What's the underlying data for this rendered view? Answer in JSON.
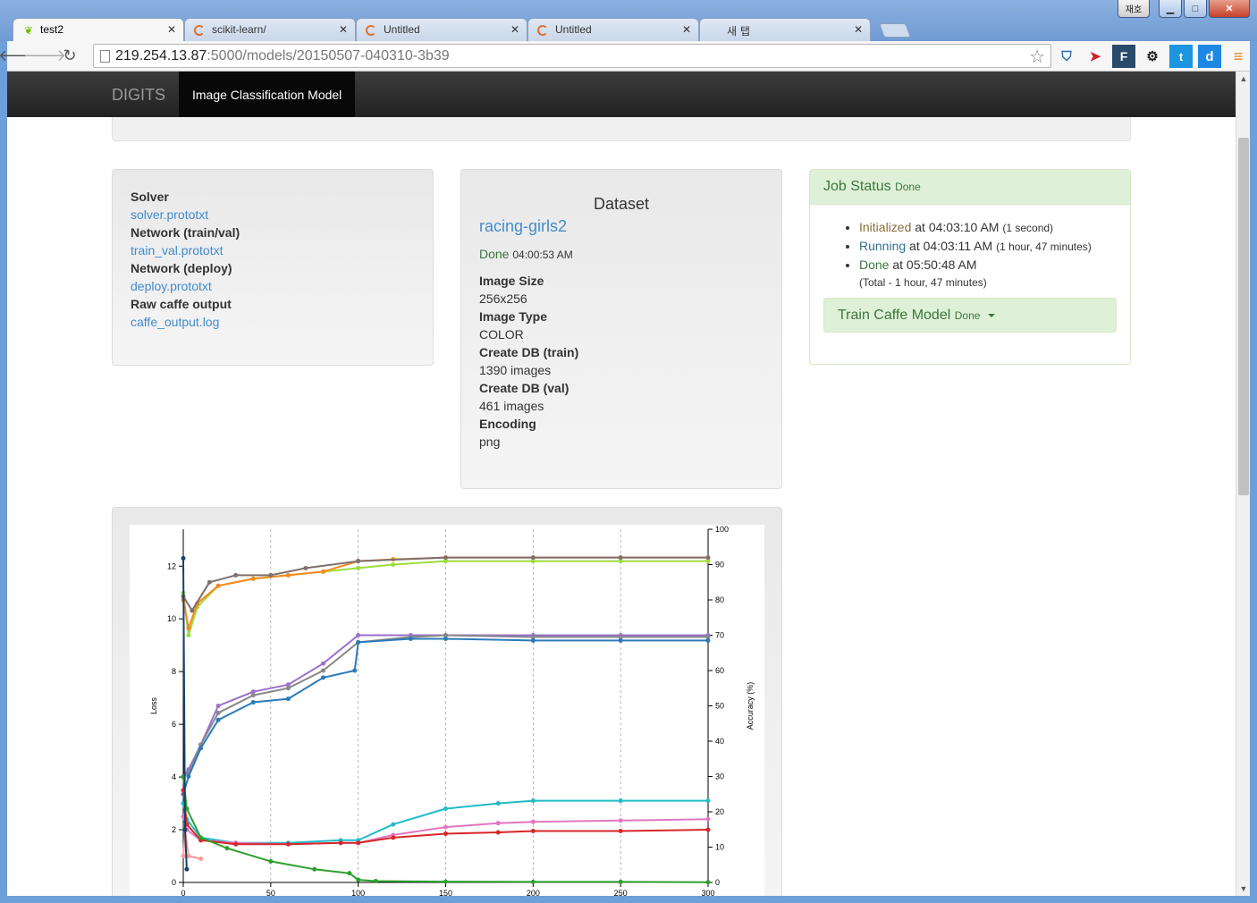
{
  "window": {
    "user_label": "재호",
    "tabs": [
      {
        "title": "test2",
        "icon": "nvidia-leaf-icon",
        "active": true
      },
      {
        "title": "scikit-learn/",
        "icon": "ipython-icon",
        "active": false
      },
      {
        "title": "Untitled",
        "icon": "ipython-icon",
        "active": false
      },
      {
        "title": "Untitled",
        "icon": "ipython-icon",
        "active": false
      },
      {
        "title": "새 탭",
        "icon": "",
        "active": false
      }
    ],
    "url_host": "219.254.13.87",
    "url_path": ":5000/models/20150507-040310-3b39"
  },
  "navbar": {
    "brand": "DIGITS",
    "active_item": "Image Classification Model"
  },
  "files": [
    {
      "label": "Solver",
      "link": "solver.prototxt"
    },
    {
      "label": "Network (train/val)",
      "link": "train_val.prototxt"
    },
    {
      "label": "Network (deploy)",
      "link": "deploy.prototxt"
    },
    {
      "label": "Raw caffe output",
      "link": "caffe_output.log"
    }
  ],
  "dataset": {
    "heading": "Dataset",
    "name": "racing-girls2",
    "status": "Done",
    "status_time": "04:00:53 AM",
    "fields": [
      {
        "label": "Image Size",
        "value": "256x256"
      },
      {
        "label": "Image Type",
        "value": "COLOR"
      },
      {
        "label": "Create DB (train)",
        "value": "1390 images"
      },
      {
        "label": "Create DB (val)",
        "value": "461 images"
      },
      {
        "label": "Encoding",
        "value": "png"
      }
    ]
  },
  "job_status": {
    "title": "Job Status",
    "state": "Done",
    "events": [
      {
        "state": "Initialized",
        "at": "at 04:03:10 AM",
        "duration": "(1 second)"
      },
      {
        "state": "Running",
        "at": "at 04:03:11 AM",
        "duration": "(1 hour, 47 minutes)"
      },
      {
        "state": "Done",
        "at": "at 05:50:48 AM",
        "duration": ""
      }
    ],
    "total": "(Total - 1 hour, 47 minutes)",
    "task_name": "Train Caffe Model",
    "task_state": "Done"
  },
  "chart_data": {
    "type": "line",
    "ylabel_left": "Loss",
    "ylabel_right": "Accuracy (%)",
    "xlim": [
      0,
      300
    ],
    "ylim_left": [
      0,
      13.4
    ],
    "ylim_right": [
      0,
      100
    ],
    "x_ticks": [
      0,
      50,
      100,
      150,
      200,
      250,
      300
    ],
    "y_ticks_left": [
      0,
      2,
      4,
      6,
      8,
      10,
      12
    ],
    "y_ticks_right": [
      0,
      10,
      20,
      30,
      40,
      50,
      60,
      70,
      80,
      90,
      100
    ],
    "grid": "vertical dashed at x ticks",
    "legend": "none visible",
    "series": [
      {
        "axis": "right",
        "color": "#9edc3c",
        "points": [
          [
            0,
            82
          ],
          [
            3,
            70
          ],
          [
            8,
            78
          ],
          [
            20,
            84
          ],
          [
            40,
            86
          ],
          [
            60,
            87
          ],
          [
            80,
            88
          ],
          [
            100,
            89
          ],
          [
            120,
            90
          ],
          [
            150,
            91
          ],
          [
            200,
            91
          ],
          [
            250,
            91
          ],
          [
            300,
            91
          ]
        ]
      },
      {
        "axis": "right",
        "color": "#f58a1f",
        "points": [
          [
            0,
            80
          ],
          [
            3,
            72
          ],
          [
            8,
            79
          ],
          [
            20,
            84
          ],
          [
            40,
            86
          ],
          [
            60,
            87
          ],
          [
            80,
            88
          ],
          [
            100,
            91
          ],
          [
            120,
            91.5
          ],
          [
            150,
            92
          ],
          [
            200,
            92
          ],
          [
            250,
            92
          ],
          [
            300,
            92
          ]
        ]
      },
      {
        "axis": "right",
        "color": "#7f6f6f",
        "points": [
          [
            0,
            81
          ],
          [
            5,
            77
          ],
          [
            15,
            85
          ],
          [
            30,
            87
          ],
          [
            50,
            87
          ],
          [
            70,
            89
          ],
          [
            100,
            91
          ],
          [
            150,
            92
          ],
          [
            200,
            92
          ],
          [
            250,
            92
          ],
          [
            300,
            92
          ]
        ]
      },
      {
        "axis": "right",
        "color": "#9b6fcf",
        "points": [
          [
            0,
            30
          ],
          [
            3,
            32
          ],
          [
            10,
            39
          ],
          [
            20,
            50
          ],
          [
            40,
            54
          ],
          [
            60,
            56
          ],
          [
            80,
            62
          ],
          [
            100,
            70
          ],
          [
            130,
            70
          ],
          [
            150,
            70
          ],
          [
            200,
            70
          ],
          [
            250,
            70
          ],
          [
            300,
            70
          ]
        ]
      },
      {
        "axis": "right",
        "color": "#888888",
        "points": [
          [
            0,
            30
          ],
          [
            3,
            31
          ],
          [
            10,
            39
          ],
          [
            20,
            48
          ],
          [
            40,
            53
          ],
          [
            60,
            55
          ],
          [
            80,
            60
          ],
          [
            100,
            68
          ],
          [
            130,
            69.5
          ],
          [
            150,
            70
          ],
          [
            200,
            69.5
          ],
          [
            250,
            69.5
          ],
          [
            300,
            69.5
          ]
        ]
      },
      {
        "axis": "right",
        "color": "#2b7bb9",
        "points": [
          [
            0,
            25
          ],
          [
            3,
            30
          ],
          [
            10,
            38
          ],
          [
            20,
            46
          ],
          [
            40,
            51
          ],
          [
            60,
            52
          ],
          [
            80,
            58
          ],
          [
            98,
            60
          ],
          [
            100,
            68
          ],
          [
            130,
            69
          ],
          [
            150,
            69
          ],
          [
            200,
            68.5
          ],
          [
            250,
            68.5
          ],
          [
            300,
            68.5
          ]
        ]
      },
      {
        "axis": "left",
        "color": "#1fbcc8",
        "points": [
          [
            0,
            3.0
          ],
          [
            2,
            2.4
          ],
          [
            10,
            1.7
          ],
          [
            30,
            1.5
          ],
          [
            60,
            1.5
          ],
          [
            90,
            1.6
          ],
          [
            100,
            1.6
          ],
          [
            120,
            2.2
          ],
          [
            150,
            2.8
          ],
          [
            180,
            3.0
          ],
          [
            200,
            3.1
          ],
          [
            250,
            3.1
          ],
          [
            300,
            3.1
          ]
        ]
      },
      {
        "axis": "left",
        "color": "#e377c2",
        "points": [
          [
            0,
            2.5
          ],
          [
            2,
            2.0
          ],
          [
            10,
            1.6
          ],
          [
            30,
            1.5
          ],
          [
            60,
            1.45
          ],
          [
            90,
            1.5
          ],
          [
            100,
            1.5
          ],
          [
            120,
            1.8
          ],
          [
            150,
            2.1
          ],
          [
            180,
            2.25
          ],
          [
            200,
            2.3
          ],
          [
            250,
            2.35
          ],
          [
            300,
            2.4
          ]
        ]
      },
      {
        "axis": "left",
        "color": "#d62728",
        "points": [
          [
            0,
            3.5
          ],
          [
            2,
            2.2
          ],
          [
            10,
            1.6
          ],
          [
            30,
            1.45
          ],
          [
            60,
            1.45
          ],
          [
            90,
            1.5
          ],
          [
            100,
            1.5
          ],
          [
            120,
            1.7
          ],
          [
            150,
            1.85
          ],
          [
            180,
            1.9
          ],
          [
            200,
            1.95
          ],
          [
            250,
            1.95
          ],
          [
            300,
            2.0
          ]
        ]
      },
      {
        "axis": "left",
        "color": "#2ca02c",
        "points": [
          [
            0,
            4.0
          ],
          [
            2,
            2.8
          ],
          [
            10,
            1.7
          ],
          [
            25,
            1.3
          ],
          [
            50,
            0.8
          ],
          [
            75,
            0.5
          ],
          [
            95,
            0.35
          ],
          [
            100,
            0.1
          ],
          [
            110,
            0.05
          ],
          [
            150,
            0.03
          ],
          [
            200,
            0.02
          ],
          [
            250,
            0.02
          ],
          [
            300,
            0.01
          ]
        ]
      },
      {
        "axis": "left",
        "color": "#ff9896",
        "points": [
          [
            0,
            1.0
          ],
          [
            1,
            2.0
          ],
          [
            3,
            1.0
          ],
          [
            10,
            0.9
          ]
        ]
      },
      {
        "axis": "left",
        "color": "#17426b",
        "points": [
          [
            0,
            12.3
          ],
          [
            1,
            2.0
          ],
          [
            2,
            0.5
          ]
        ]
      }
    ]
  }
}
